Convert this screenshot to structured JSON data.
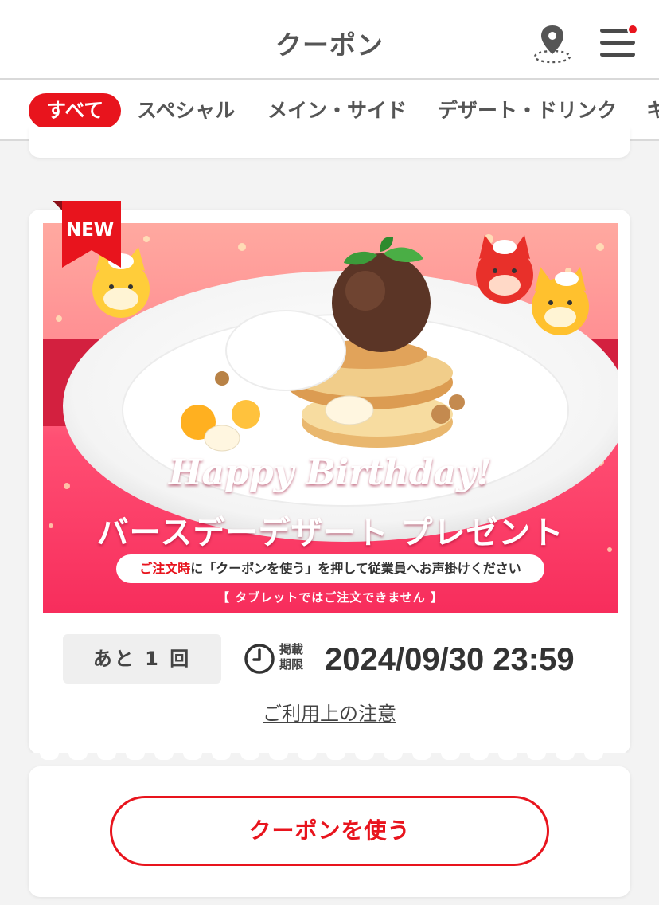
{
  "header": {
    "title": "クーポン",
    "location_icon": "map-pin-icon",
    "menu_icon": "hamburger-menu-icon",
    "notification_color": "#e8141d"
  },
  "tabs": [
    {
      "label": "すべて",
      "active": true
    },
    {
      "label": "スペシャル",
      "active": false
    },
    {
      "label": "メイン・サイド",
      "active": false
    },
    {
      "label": "デザート・ドリンク",
      "active": false
    },
    {
      "label": "キ",
      "active": false
    }
  ],
  "coupon": {
    "badge": "NEW",
    "banner": {
      "title": "Happy Birthday!",
      "subtitle": "バースデーデザート プレゼント",
      "instruction_highlight": "ご注文時",
      "instruction_rest": "に「クーポンを使う」を押して従業員へお声掛けください",
      "note": "【 タブレットではご注文できません 】"
    },
    "remaining_uses": "あと 1 回",
    "expiry_label": "掲載期限",
    "expiry_date": "2024/09/30 23:59",
    "notes_link": "ご利用上の注意",
    "use_button": "クーポンを使う"
  },
  "colors": {
    "accent": "#e8141d",
    "background": "#f3f3f3",
    "banner_pink": "#ff6e86"
  }
}
